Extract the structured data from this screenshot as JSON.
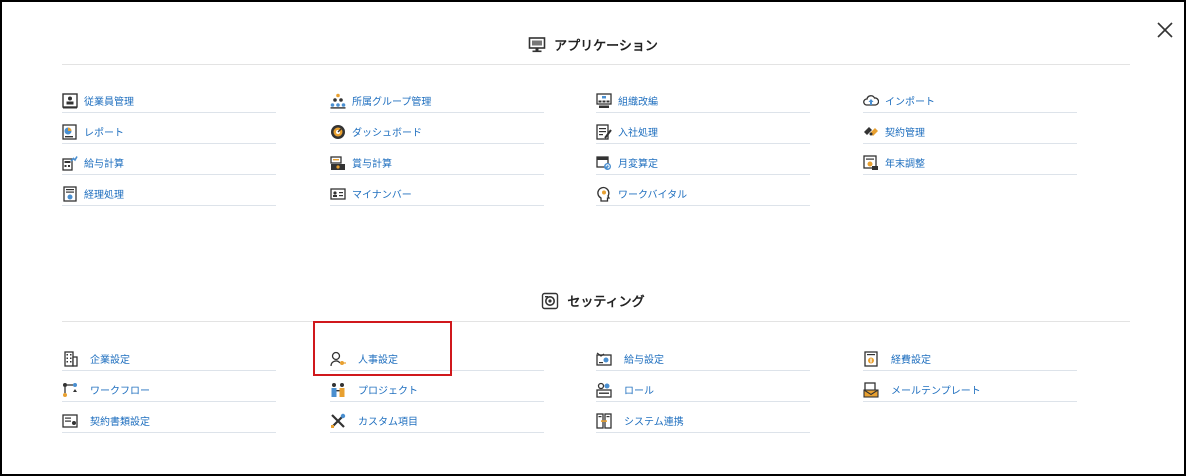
{
  "applications": {
    "title": "アプリケーション",
    "title_icon": "monitor-icon",
    "items": [
      {
        "label": "従業員管理",
        "icon": "employee-book-icon"
      },
      {
        "label": "所属グループ管理",
        "icon": "group-pyramid-icon"
      },
      {
        "label": "組織改編",
        "icon": "org-chart-icon"
      },
      {
        "label": "インポート",
        "icon": "cloud-upload-icon"
      },
      {
        "label": "レポート",
        "icon": "report-chart-icon"
      },
      {
        "label": "ダッシュボード",
        "icon": "dashboard-gauge-icon"
      },
      {
        "label": "入社処理",
        "icon": "document-pen-icon"
      },
      {
        "label": "契約管理",
        "icon": "handshake-icon"
      },
      {
        "label": "給与計算",
        "icon": "calculator-chart-icon"
      },
      {
        "label": "賞与計算",
        "icon": "bonus-money-icon"
      },
      {
        "label": "月変算定",
        "icon": "calendar-refresh-icon"
      },
      {
        "label": "年末調整",
        "icon": "yearend-adjust-icon"
      },
      {
        "label": "経理処理",
        "icon": "accounting-document-icon"
      },
      {
        "label": "マイナンバー",
        "icon": "id-card-icon"
      },
      {
        "label": "ワークバイタル",
        "icon": "head-profile-icon"
      }
    ]
  },
  "settings": {
    "title": "セッティング",
    "title_icon": "settings-gear-icon",
    "items": [
      {
        "label": "企業設定",
        "icon": "building-icon"
      },
      {
        "label": "人事設定",
        "icon": "user-key-icon"
      },
      {
        "label": "給与設定",
        "icon": "payroll-setting-icon"
      },
      {
        "label": "経費設定",
        "icon": "expense-document-icon"
      },
      {
        "label": "ワークフロー",
        "icon": "workflow-icon"
      },
      {
        "label": "プロジェクト",
        "icon": "project-team-icon"
      },
      {
        "label": "ロール",
        "icon": "role-users-icon"
      },
      {
        "label": "メールテンプレート",
        "icon": "mail-template-icon"
      },
      {
        "label": "契約書類設定",
        "icon": "contract-document-icon"
      },
      {
        "label": "カスタム項目",
        "icon": "tools-wrench-icon"
      },
      {
        "label": "システム連携",
        "icon": "system-link-icon"
      }
    ]
  },
  "colors": {
    "link": "#1f6fbf",
    "highlight": "#d0181c",
    "icon_dark": "#3a3a3a",
    "icon_orange": "#e8a030",
    "icon_blue": "#4a8fd0"
  }
}
